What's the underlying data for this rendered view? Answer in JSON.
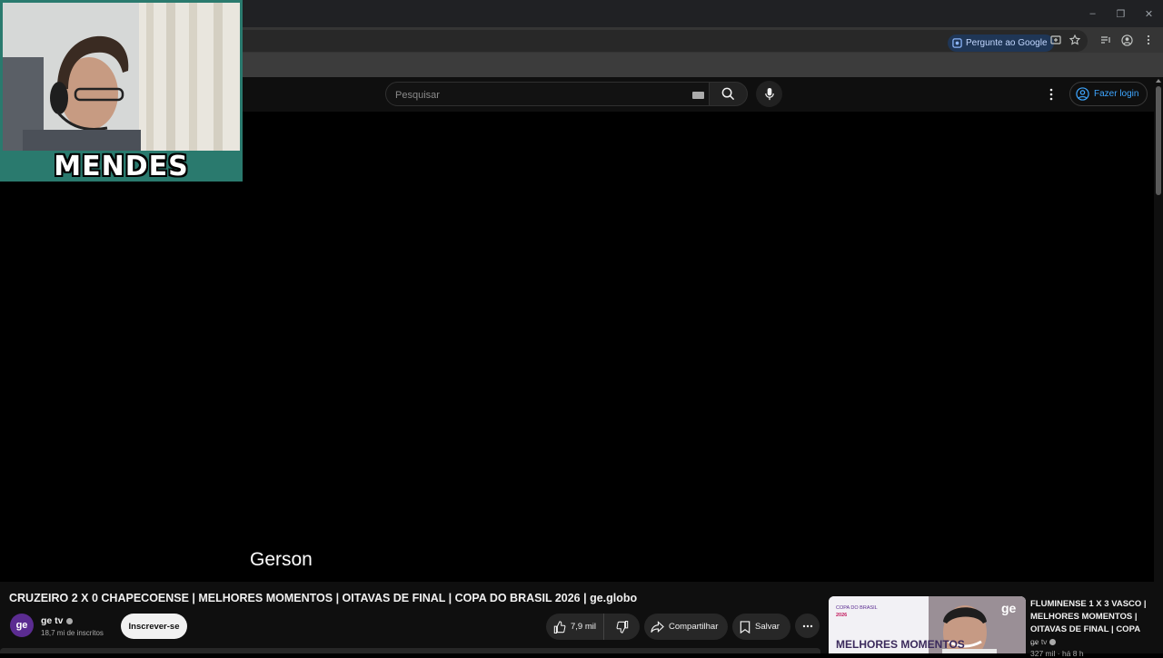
{
  "browser": {
    "ask_google": "Pergunte ao Google",
    "window_controls": [
      "–",
      "❐",
      "✕"
    ]
  },
  "header": {
    "search_placeholder": "Pesquisar",
    "login_label": "Fazer login"
  },
  "webcam": {
    "name": "MENDES"
  },
  "player": {
    "subtitle": "Gerson"
  },
  "video": {
    "title": "CRUZEIRO 2 X 0 CHAPECOENSE | MELHORES MOMENTOS | OITAVAS DE FINAL | COPA DO BRASIL 2026 | ge.globo",
    "channel_avatar": "ge",
    "channel_name": "ge tv",
    "subscribers": "18,7 mi de inscritos",
    "subscribe_label": "Inscrever-se",
    "like_count": "7,9 mil",
    "share_label": "Compartilhar",
    "save_label": "Salvar"
  },
  "recommendation": {
    "title": "FLUMINENSE 1 X 3 VASCO | MELHORES MOMENTOS | OITAVAS DE FINAL | COPA ...",
    "channel": "ge tv",
    "meta": "327 mil · há 8 h",
    "thumb_badge": "COPA DO BRASIL",
    "thumb_year": "2026",
    "thumb_logo": "ge",
    "thumb_text": "MELHORES MOMENTOS"
  },
  "colors": {
    "accent_link": "#3ea6ff",
    "brand_purple": "#5b2c91",
    "webcam_border": "#2a7a6e"
  }
}
